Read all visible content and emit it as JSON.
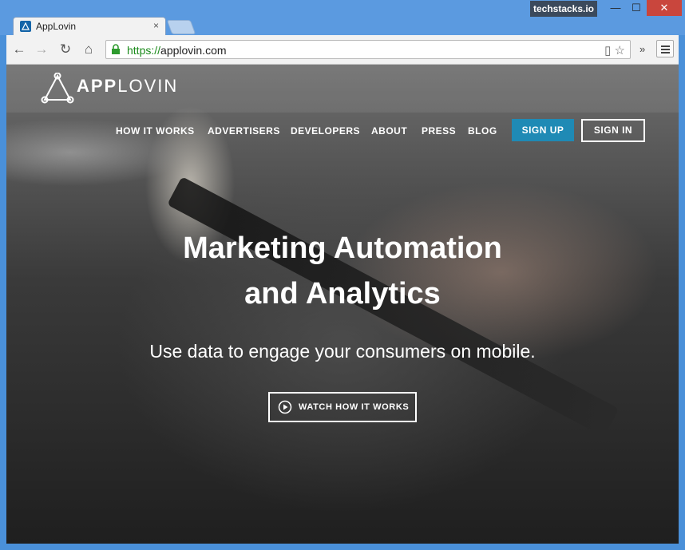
{
  "browser": {
    "tab_title": "AppLovin",
    "tab_close": "×",
    "brand_badge": "techstacks.io",
    "window_buttons": {
      "minimize": "—",
      "maximize": "☐",
      "close": "✕"
    },
    "nav_icons": {
      "back": "←",
      "forward": "→",
      "reload": "↻",
      "home": "⌂"
    },
    "url_scheme": "https://",
    "url_host": "applovin.com",
    "omni_icons": "▯ ☆",
    "overflow": "»"
  },
  "site": {
    "logo_bold": "APP",
    "logo_light": "LOVIN",
    "nav": [
      "HOW IT WORKS",
      "ADVERTISERS",
      "DEVELOPERS",
      "ABOUT",
      "PRESS",
      "BLOG"
    ],
    "signup_label": "SIGN UP",
    "signin_label": "SIGN IN",
    "headline_line1": "Marketing Automation",
    "headline_line2": "and Analytics",
    "subheadline": "Use data to engage your consumers on mobile.",
    "watch_label": "WATCH HOW IT WORKS",
    "accent_color": "#1f8ab5"
  }
}
